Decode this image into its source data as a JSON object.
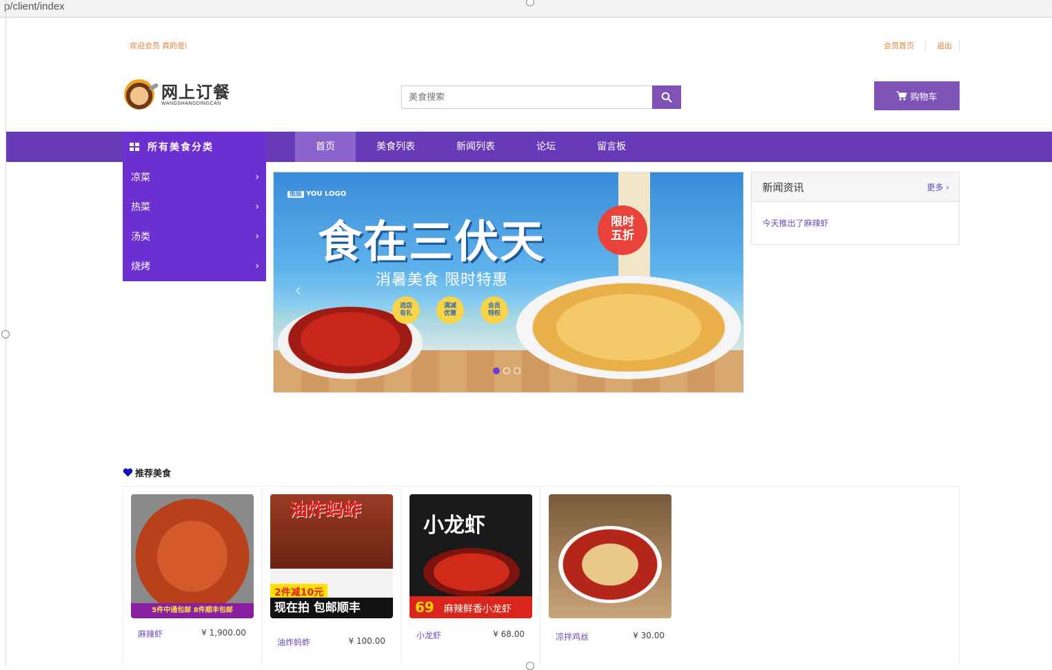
{
  "url_fragment": "p/client/index",
  "header": {
    "welcome": "欢迎会员 真的是!",
    "links": [
      "会员首页",
      "退出"
    ],
    "logo_cn": "网上订餐",
    "logo_en": "WANGSHANGDINGCAN",
    "search_placeholder": "美食搜索",
    "cart_label": "购物车"
  },
  "nav": {
    "category_title": "所有美食分类",
    "links": [
      "首页",
      "美食列表",
      "新闻列表",
      "论坛",
      "留言板"
    ],
    "active_index": 0
  },
  "categories": [
    "凉菜",
    "热菜",
    "汤类",
    "烧烤"
  ],
  "banner": {
    "logo_tag": "YOU LOGO",
    "logo_box": "图层",
    "headline": "食在三伏天",
    "subtitle": "消暑美食 限时特惠",
    "bubble": [
      "限时",
      "五折"
    ],
    "badges": [
      [
        "进店",
        "有礼"
      ],
      [
        "满减",
        "优惠"
      ],
      [
        "会员",
        "特权"
      ]
    ],
    "slide_count": 3,
    "active_slide": 0
  },
  "news": {
    "title": "新闻资讯",
    "more": "更多 ›",
    "items": [
      "今天推出了麻辣虾"
    ]
  },
  "recommend": {
    "title": "推荐美食",
    "items": [
      {
        "name": "麻辣虾",
        "price": "¥ 1,900.00",
        "img_text": "5件中通包邮 8件顺丰包邮"
      },
      {
        "name": "油炸蚂蚱",
        "price": "¥ 100.00",
        "img_title": "油炸蚂蚱",
        "img_promo": "2件减10元",
        "img_bar": "现在拍 包邮顺丰"
      },
      {
        "name": "小龙虾",
        "price": "¥ 68.00",
        "img_title": "小龙虾",
        "img_price": "69",
        "img_bar": "麻辣鲜香小龙虾"
      },
      {
        "name": "凉拌鸡丝",
        "price": "¥ 30.00"
      }
    ]
  },
  "colors": {
    "primary": "#673bb7",
    "category": "#6c2fd2",
    "accent_text": "#e8833a",
    "link": "#6a4bb8"
  }
}
